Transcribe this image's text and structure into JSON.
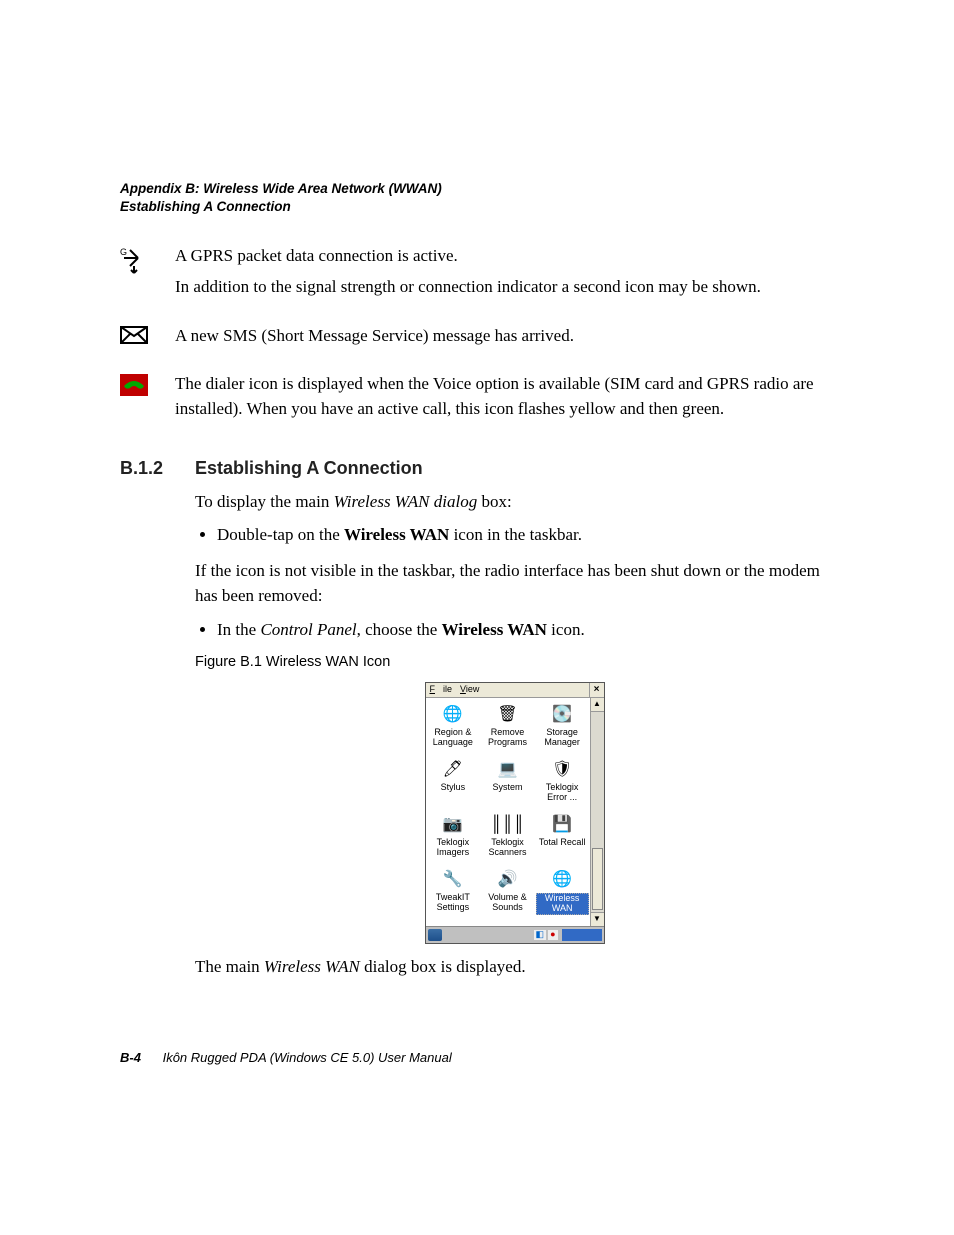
{
  "header": {
    "line1": "Appendix B: Wireless Wide Area Network (WWAN)",
    "line2": "Establishing A Connection"
  },
  "icons": [
    {
      "name": "gprs-icon",
      "text1": "A GPRS packet data connection is active.",
      "text2": "In addition to the signal strength or connection indicator a second icon may be shown."
    },
    {
      "name": "sms-icon",
      "text1": "A new SMS (Short Message Service) message has arrived."
    },
    {
      "name": "dialer-icon",
      "text1": "The dialer icon is displayed when the Voice option is available (SIM card and GPRS radio are installed). When you have an active call, this icon flashes yellow and then green."
    }
  ],
  "section": {
    "number": "B.1.2",
    "title": "Establishing A Connection",
    "intro_plain": "To display the main ",
    "intro_italic": "Wireless WAN dialog",
    "intro_rest": " box:",
    "bullet1_pre": "Double-tap on the ",
    "bullet1_bold": "Wireless WAN",
    "bullet1_post": " icon in the taskbar.",
    "p2": "If the icon is not visible in the taskbar, the radio interface has been shut down or the modem has been removed:",
    "bullet2_pre": "In the ",
    "bullet2_italic": "Control Panel",
    "bullet2_mid": ", choose the ",
    "bullet2_bold": "Wireless WAN",
    "bullet2_post": " icon.",
    "fig_caption": "Figure B.1  Wireless WAN Icon",
    "closing_pre": "The main ",
    "closing_italic": "Wireless WAN",
    "closing_post": " dialog box is displayed."
  },
  "control_panel": {
    "menu": {
      "file": "File",
      "view": "View"
    },
    "close": "×",
    "items": [
      {
        "label": "Region & Language",
        "glyph": "🌐"
      },
      {
        "label": "Remove Programs",
        "glyph": "🗑"
      },
      {
        "label": "Storage Manager",
        "glyph": "💽"
      },
      {
        "label": "Stylus",
        "glyph": "🖊"
      },
      {
        "label": "System",
        "glyph": "💻"
      },
      {
        "label": "Teklogix Error ...",
        "glyph": "🛡"
      },
      {
        "label": "Teklogix Imagers",
        "glyph": "📷"
      },
      {
        "label": "Teklogix Scanners",
        "glyph": "║║║"
      },
      {
        "label": "Total Recall",
        "glyph": "💾"
      },
      {
        "label": "TweakIT Settings",
        "glyph": "🔧"
      },
      {
        "label": "Volume & Sounds",
        "glyph": "🔊"
      },
      {
        "label": "Wireless WAN",
        "glyph": "🌐",
        "selected": true
      }
    ],
    "scroll_up": "▲",
    "scroll_down": "▼"
  },
  "footer": {
    "page": "B-4",
    "title": "Ikôn Rugged PDA (Windows CE 5.0) User Manual"
  }
}
